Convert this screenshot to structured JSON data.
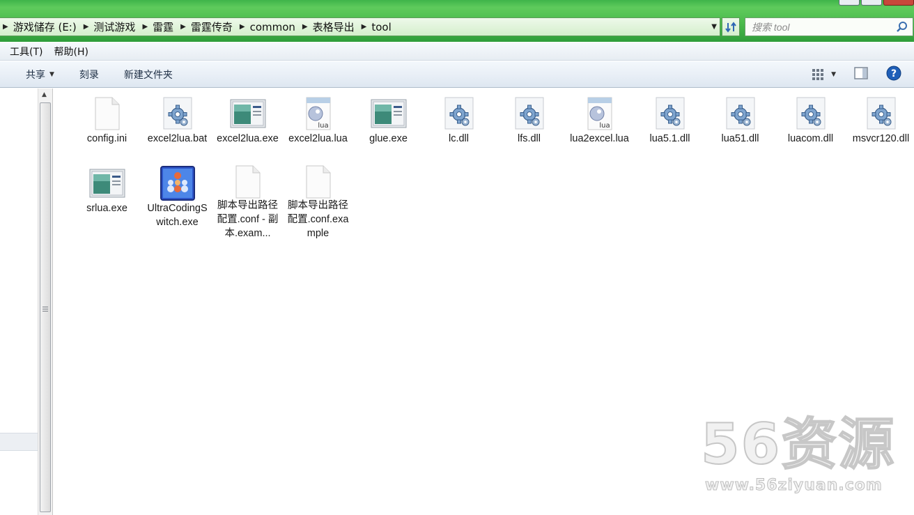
{
  "window": {
    "breadcrumbs": [
      "游戏储存 (E:)",
      "测试游戏",
      "雷霆",
      "雷霆传奇",
      "common",
      "表格导出",
      "tool"
    ],
    "search_placeholder": "搜索 tool"
  },
  "menubar": {
    "items": [
      "工具(T)",
      "帮助(H)"
    ]
  },
  "toolbar": {
    "share_label": "共享",
    "burn_label": "刻录",
    "new_folder_label": "新建文件夹"
  },
  "files": [
    {
      "name": "config.ini",
      "icon": "ini-file-icon",
      "type": "ini"
    },
    {
      "name": "excel2lua.bat",
      "icon": "bat-file-icon",
      "type": "gear"
    },
    {
      "name": "excel2lua.exe",
      "icon": "exe-file-icon",
      "type": "exe"
    },
    {
      "name": "excel2lua.lua",
      "icon": "lua-file-icon",
      "type": "lua"
    },
    {
      "name": "glue.exe",
      "icon": "exe-file-icon",
      "type": "exe"
    },
    {
      "name": "lc.dll",
      "icon": "dll-file-icon",
      "type": "gear"
    },
    {
      "name": "lfs.dll",
      "icon": "dll-file-icon",
      "type": "gear"
    },
    {
      "name": "lua2excel.lua",
      "icon": "lua-file-icon",
      "type": "lua"
    },
    {
      "name": "lua5.1.dll",
      "icon": "dll-file-icon",
      "type": "gear"
    },
    {
      "name": "lua51.dll",
      "icon": "dll-file-icon",
      "type": "gear"
    },
    {
      "name": "luacom.dll",
      "icon": "dll-file-icon",
      "type": "gear"
    },
    {
      "name": "msvcr120.dll",
      "icon": "dll-file-icon",
      "type": "gear"
    },
    {
      "name": "srlua.exe",
      "icon": "exe-file-icon",
      "type": "exe"
    },
    {
      "name": "UltraCodingSwitch.exe",
      "icon": "app-icon",
      "type": "app"
    },
    {
      "name": "脚本导出路径配置.conf - 副本.exam...",
      "icon": "blank-file-icon",
      "type": "blank"
    },
    {
      "name": "脚本导出路径配置.conf.example",
      "icon": "blank-file-icon",
      "type": "blank"
    }
  ],
  "watermark": {
    "brand": "56资源",
    "url": "www.56ziyuan.com"
  },
  "colors": {
    "accent_green": "#48b84a",
    "toolbar_text": "#1e2f45",
    "help_blue": "#1f5fb8"
  }
}
